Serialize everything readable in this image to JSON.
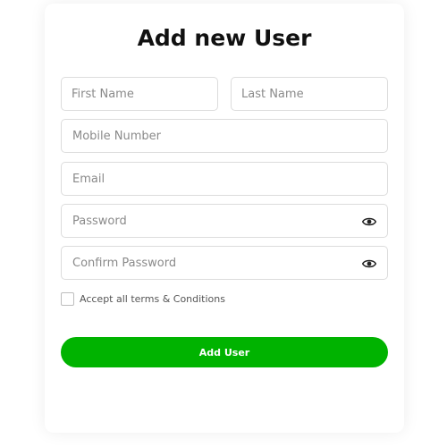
{
  "form": {
    "title": "Add new User",
    "first_name_placeholder": "First Name",
    "last_name_placeholder": "Last Name",
    "mobile_placeholder": "Mobile Number",
    "email_placeholder": "Email",
    "password_placeholder": "Password",
    "confirm_password_placeholder": "Confirm Password",
    "terms_label": "Accept all terms & Conditions",
    "terms_checked": false,
    "submit_label": "Add User"
  },
  "colors": {
    "accent": "#00b300",
    "field_border": "#dcdcdc",
    "placeholder": "#8a8a8a",
    "title": "#111111"
  },
  "icons": {
    "password_toggle": "eye-icon",
    "confirm_password_toggle": "eye-icon"
  }
}
